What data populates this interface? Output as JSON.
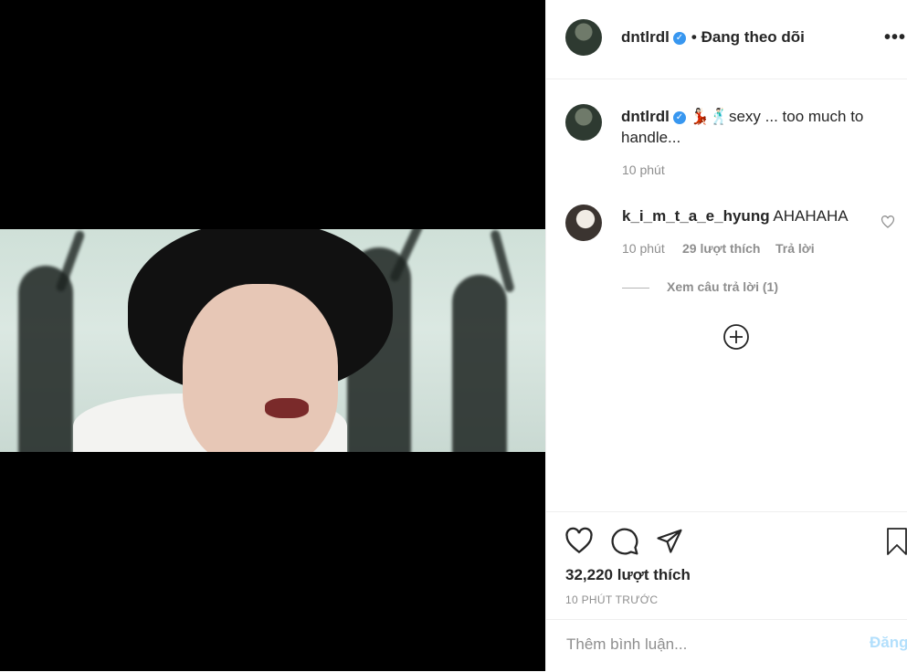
{
  "post": {
    "author": "dntlrdl",
    "follow_status": "• Đang theo dõi",
    "caption_user": "dntlrdl",
    "caption_emoji": "💃🏻🕺🏻",
    "caption_text": "sexy ... too much to handle...",
    "caption_time": "10 phút"
  },
  "comment": {
    "user": "k_i_m_t_a_e_hyung",
    "text": "AHAHAHA",
    "time": "10 phút",
    "likes": "29 lượt thích",
    "reply_label": "Trả lời",
    "view_replies": "Xem câu trả lời (1)"
  },
  "stats": {
    "likes": "32,220 lượt thích",
    "timestamp": "10 PHÚT TRƯỚC"
  },
  "composer": {
    "placeholder": "Thêm bình luận...",
    "post_label": "Đăng"
  },
  "icons": {
    "more": "more-options-icon",
    "verified": "verified-badge-icon",
    "like": "heart-icon",
    "comment": "comment-icon",
    "share": "send-icon",
    "save": "bookmark-icon",
    "load_more": "plus-circle-icon"
  },
  "colors": {
    "verified": "#3897f0",
    "muted": "#8e8e8e",
    "post_disabled": "#b2dffc"
  }
}
